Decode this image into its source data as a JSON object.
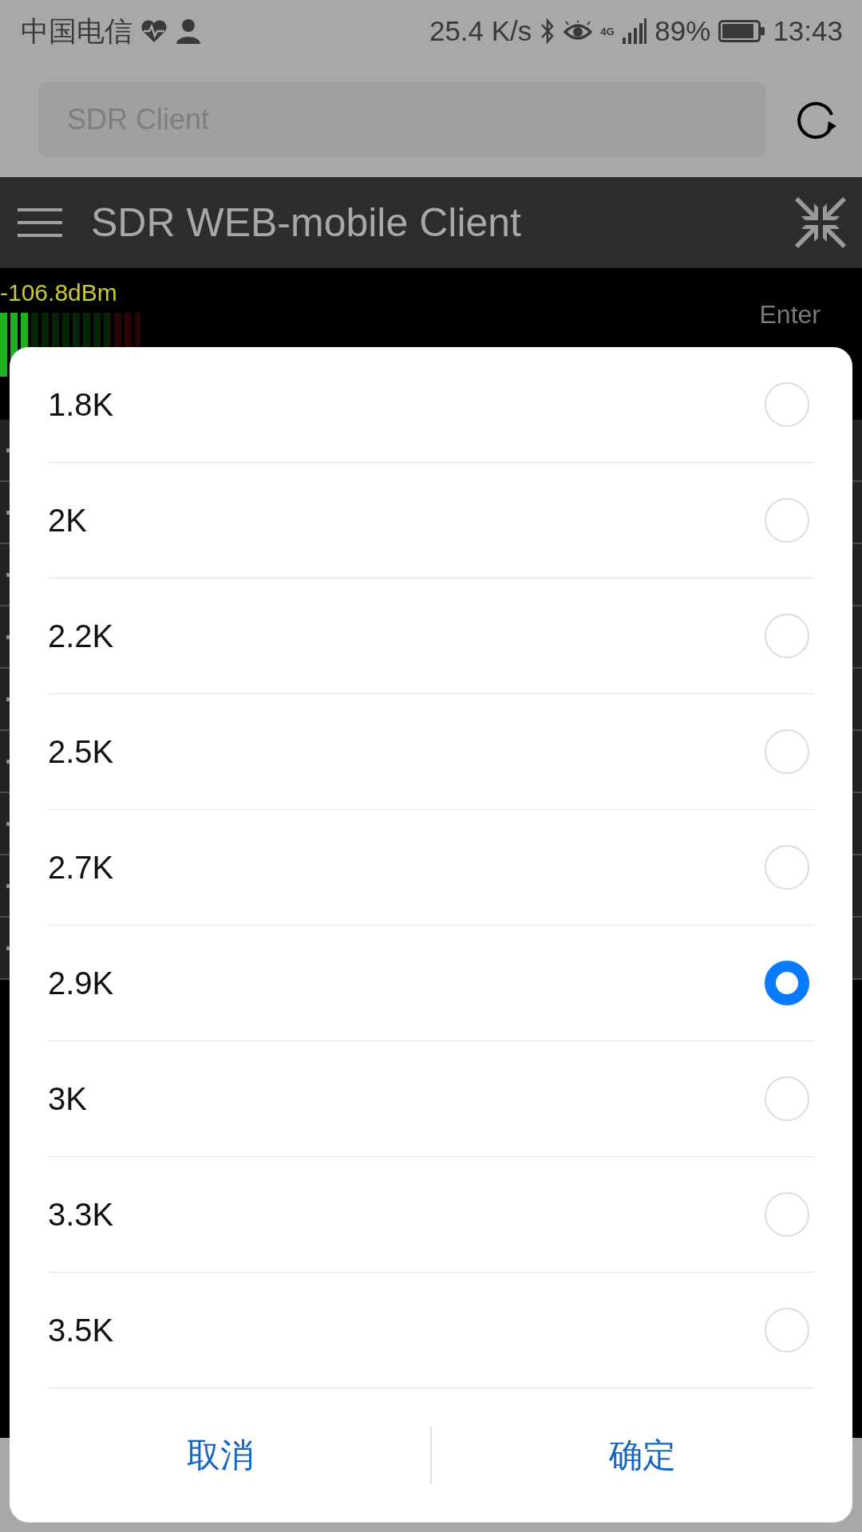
{
  "status_bar": {
    "carrier": "中国电信",
    "speed": "25.4 K/s",
    "network": "4G",
    "battery": "89%",
    "time": "13:43"
  },
  "address_bar": {
    "text": "SDR Client"
  },
  "app_bar": {
    "title": "SDR WEB-mobile Client"
  },
  "tuner": {
    "signal": "-106.8dBm",
    "meter": {
      "level": 0.21
    },
    "enter": "Enter"
  },
  "dialog": {
    "options": [
      {
        "label": "1.8K",
        "selected": false
      },
      {
        "label": "2K",
        "selected": false
      },
      {
        "label": "2.2K",
        "selected": false
      },
      {
        "label": "2.5K",
        "selected": false
      },
      {
        "label": "2.7K",
        "selected": false
      },
      {
        "label": "2.9K",
        "selected": true
      },
      {
        "label": "3K",
        "selected": false
      },
      {
        "label": "3.3K",
        "selected": false
      },
      {
        "label": "3.5K",
        "selected": false
      }
    ],
    "buttons": [
      "取消",
      "确定"
    ]
  }
}
